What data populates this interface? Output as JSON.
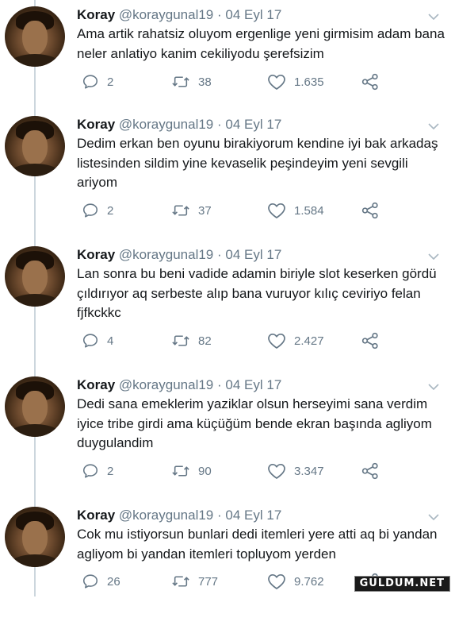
{
  "tweets": [
    {
      "name": "Koray",
      "handle": "@koraygunal19",
      "separator": "·",
      "date": "04 Eyl 17",
      "text": "Ama artik rahatsiz oluyom ergenlige yeni girmisim adam bana neler anlatiyo kanim cekiliyodu şerefsizim",
      "replies": "2",
      "retweets": "38",
      "likes": "1.635"
    },
    {
      "name": "Koray",
      "handle": "@koraygunal19",
      "separator": "·",
      "date": "04 Eyl 17",
      "text": "Dedim erkan ben oyunu birakiyorum kendine iyi bak arkadaş listesinden sildim yine kevaselik peşindeyim yeni sevgili ariyom",
      "replies": "2",
      "retweets": "37",
      "likes": "1.584"
    },
    {
      "name": "Koray",
      "handle": "@koraygunal19",
      "separator": "·",
      "date": "04 Eyl 17",
      "text": "Lan sonra bu beni vadide adamin biriyle slot keserken gördü çıldırıyor aq serbeste alıp bana vuruyor kılıç ceviriyo felan fjfkckkc",
      "replies": "4",
      "retweets": "82",
      "likes": "2.427"
    },
    {
      "name": "Koray",
      "handle": "@koraygunal19",
      "separator": "·",
      "date": "04 Eyl 17",
      "text": "Dedi sana emeklerim yaziklar olsun herseyimi sana verdim iyice tribe girdi ama küçüğüm bende ekran başında agliyom duygulandim",
      "replies": "2",
      "retweets": "90",
      "likes": "3.347"
    },
    {
      "name": "Koray",
      "handle": "@koraygunal19",
      "separator": "·",
      "date": "04 Eyl 17",
      "text": "Cok mu istiyorsun bunlari dedi itemleri yere atti aq bi yandan agliyom bi yandan itemleri topluyom yerden",
      "replies": "26",
      "retweets": "777",
      "likes": "9.762"
    }
  ],
  "watermark": "GULDUM.NET",
  "colors": {
    "name": "#14171a",
    "secondary": "#657786",
    "thread_line": "#ccd6dd"
  },
  "icons": [
    "reply-icon",
    "retweet-icon",
    "like-icon",
    "share-icon",
    "chevron-down-icon"
  ]
}
